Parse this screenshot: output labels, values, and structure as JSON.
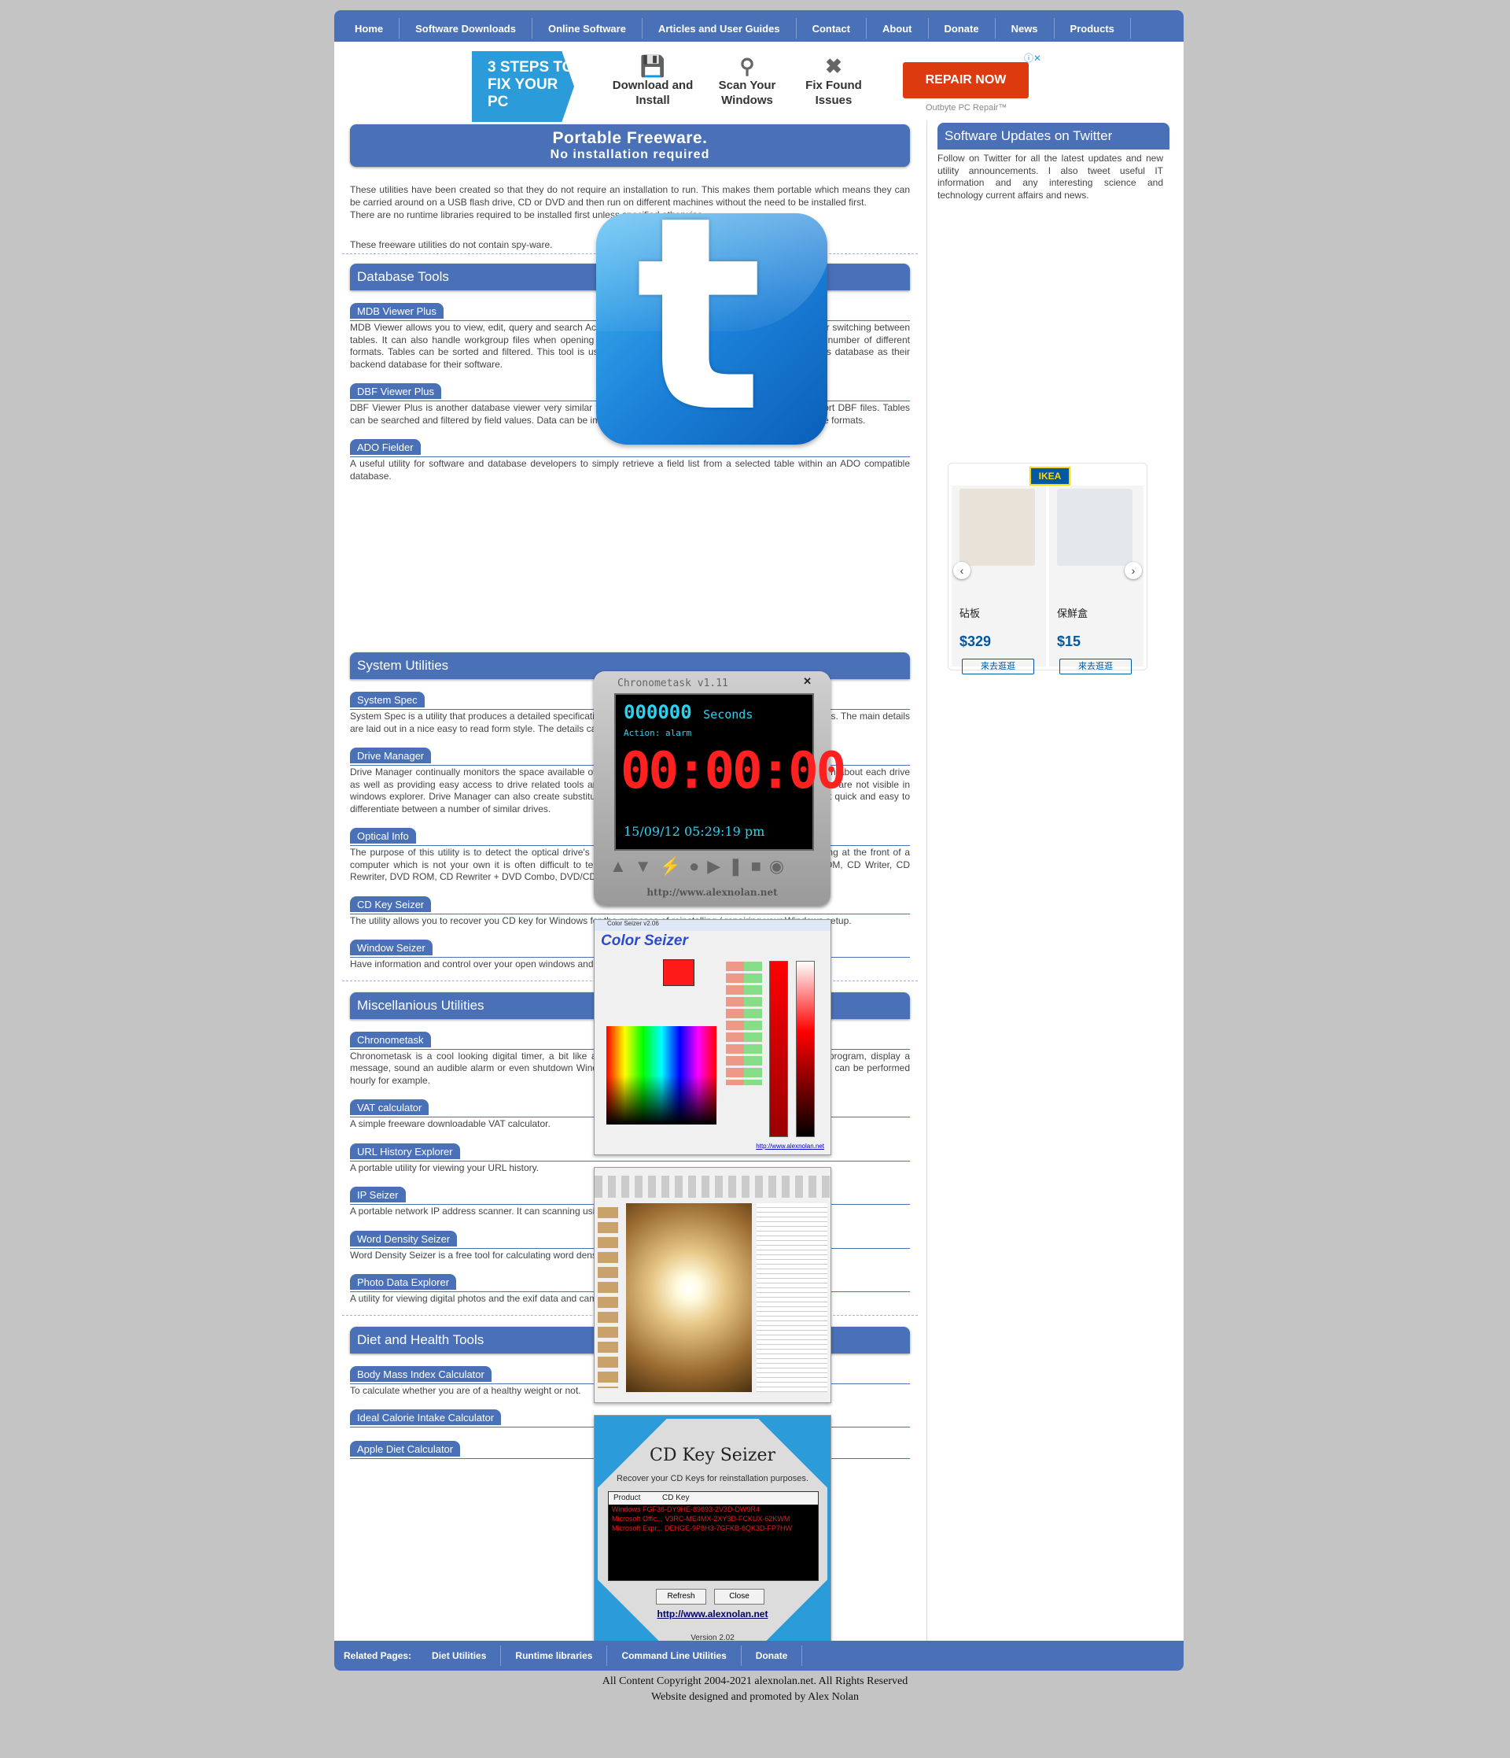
{
  "nav": {
    "items": [
      "Home",
      "Software Downloads",
      "Online Software",
      "Articles and User Guides",
      "Contact",
      "About",
      "Donate",
      "News",
      "Products"
    ]
  },
  "ad": {
    "steps_label": "3 STEPS TO FIX YOUR PC",
    "step1": "Download and Install",
    "step2": "Scan Your Windows",
    "step3": "Fix Found Issues",
    "cta": "REPAIR NOW",
    "brand": "Outbyte PC Repair™",
    "ad_choice": "ⓘ✕"
  },
  "intro": {
    "title": "Portable Freeware.",
    "subtitle": "No installation required",
    "para1": "These utilities have been created so that they do not require an installation to run. This makes them portable which means they can be carried around on a USB flash drive, CD or DVD and then run on different machines without the need to be installed first.",
    "para2": "There are no runtime libraries required to be installed first unless specified otherwise.",
    "para3": "These freeware utilities do not contain spy-ware."
  },
  "sections": [
    {
      "title": "Database Tools",
      "tools": [
        {
          "name": "MDB Viewer Plus",
          "desc": "MDB Viewer allows you to view, edit, query and search Access MDB and Accdb files. It has a tabbed interface for switching between tables. It can also handle workgroup files when opening MDB files. Data can be imported and exported to a number of different formats. Tables can be sorted and filtered. This tool is useful for software developers who are using an Access database as their backend database for their software."
        },
        {
          "name": "DBF Viewer Plus",
          "desc": "DBF Viewer Plus is another database viewer very similar to MDB Viewer Plus. It can view, edit, import and export DBF files. Tables can be searched and filtered by field values. Data can be imported and export to and from a number of different file formats."
        },
        {
          "name": "ADO Fielder",
          "desc": "A useful utility for software and database developers to simply retrieve a field list from a selected table within an ADO compatible database."
        }
      ]
    },
    {
      "title": "System Utilities",
      "tools": [
        {
          "name": "System Spec",
          "desc": "System Spec is a utility that produces a detailed specification of your computer's hardware, software  and capabilities. The main details are laid out in a nice easy to read form style. The details can be saved, printed and exported."
        },
        {
          "name": "Drive Manager",
          "desc": "Drive Manager continually monitors the space available of all of your drive letters and displays detailed information about each drive as well as providing easy access to drive related tools and functions. It can also be used to hide drives so there are not visible in windows explorer. Drive Manager can also create substitute drive letters for local folders. Drive Manager makes it quick and easy to differentiate between a number of similar drives."
        },
        {
          "name": "Optical Info",
          "desc": "The purpose of this utility is to detect the optical drive's (CD / DVD drives) Read/Write capabilities. When looking at the front of a computer which is not your own it is often difficult to tell whether the optical drive installed is either a CD ROM, CD Writer, CD Rewriter, DVD ROM, CD Rewriter + DVD Combo, DVD/CD Rewriter etc."
        },
        {
          "name": "CD Key Seizer",
          "desc": "The utility allows you to recover you CD key for Windows for the purposes of reinstalling / repairing your Windows setup."
        },
        {
          "name": "Window Seizer",
          "desc": "Have information and control over your open windows and running processes."
        }
      ]
    },
    {
      "title": "Miscellanious Utilities",
      "tools": [
        {
          "name": "Chronometask",
          "desc": "Chronometask is a cool looking digital timer, a bit like an oven timer. When the time is up it can execute a program, display a message, sound an audible alarm or even shutdown Windows. The time can be repeated in a loop so that a task can be performed hourly for example."
        },
        {
          "name": "VAT calculator",
          "desc": "A simple freeware downloadable VAT calculator."
        },
        {
          "name": "URL History Explorer",
          "desc": "A portable utility for viewing your URL history."
        },
        {
          "name": "IP Seizer",
          "desc": "A portable network IP address scanner. It can scanning using two different modes; fast and thorough."
        },
        {
          "name": "Word Density Seizer",
          "desc": "Word Density Seizer is a free tool for calculating word density and counting words in text."
        },
        {
          "name": "Photo Data Explorer",
          "desc": "A utility for viewing digital photos and the exif data and camera settings stored within the photos."
        }
      ]
    },
    {
      "title": "Diet and Health Tools",
      "tools": [
        {
          "name": "Body Mass Index Calculator",
          "desc": "To calculate whether you are of a healthy weight or not."
        },
        {
          "name": "Ideal Calorie Intake Calculator",
          "desc": ""
        },
        {
          "name": "Apple Diet Calculator",
          "desc": ""
        }
      ]
    }
  ],
  "sidebar": {
    "twitter_title": "Software Updates on Twitter",
    "twitter_text": "Follow on Twitter for all the latest updates and new utility announcements. I also tweet useful IT information and any interesting science and technology current affairs and news."
  },
  "ikea": {
    "logo": "IKEA",
    "items": [
      {
        "name": "砧板",
        "price": "$329",
        "button": "來去逛逛"
      },
      {
        "name": "保鮮盒",
        "price": "$15",
        "button": "來去逛逛"
      }
    ]
  },
  "chrono": {
    "title": "Chronometask v1.11",
    "counter": "000000",
    "counter_unit": "Seconds",
    "action": "Action: alarm",
    "big": "00:00:00",
    "datetime": "15/09/12 05:29:19 pm",
    "url": "http://www.alexnolan.net"
  },
  "colorseizer": {
    "window_title": "Color Seizer  v2.06",
    "logo": "Color Seizer",
    "url": "http://www.alexnolan.net"
  },
  "cdkey": {
    "title": "CD Key Seizer",
    "subtitle": "Recover your CD Keys for reinstallation purposes.",
    "col1": "Product",
    "col2": "CD Key",
    "rows": [
      "Windows          FGF36-DY9HE-89693-2V3D-DW9R4",
      "Microsoft Offic...  V3RC-ME4MX-2XY3D-FCKUX-62KWM",
      "Microsoft Expr...  DEHGE-9P8H3-7GFKB-6QK3D-FP7HW"
    ],
    "refresh": "Refresh",
    "close": "Close",
    "url": "http://www.alexnolan.net",
    "version": "Version 2.02"
  },
  "bottom_nav": {
    "label": "Related Pages:",
    "items": [
      "Diet Utilities",
      "Runtime libraries",
      "Command Line Utilities",
      "Donate"
    ]
  },
  "footer": {
    "line1": "All Content Copyright 2004-2021 alexnolan.net. All Rights Reserved",
    "line2": "Website designed and promoted by Alex Nolan"
  },
  "colors": {
    "accent": "#4a71b7",
    "background": "#c4c4c4"
  }
}
